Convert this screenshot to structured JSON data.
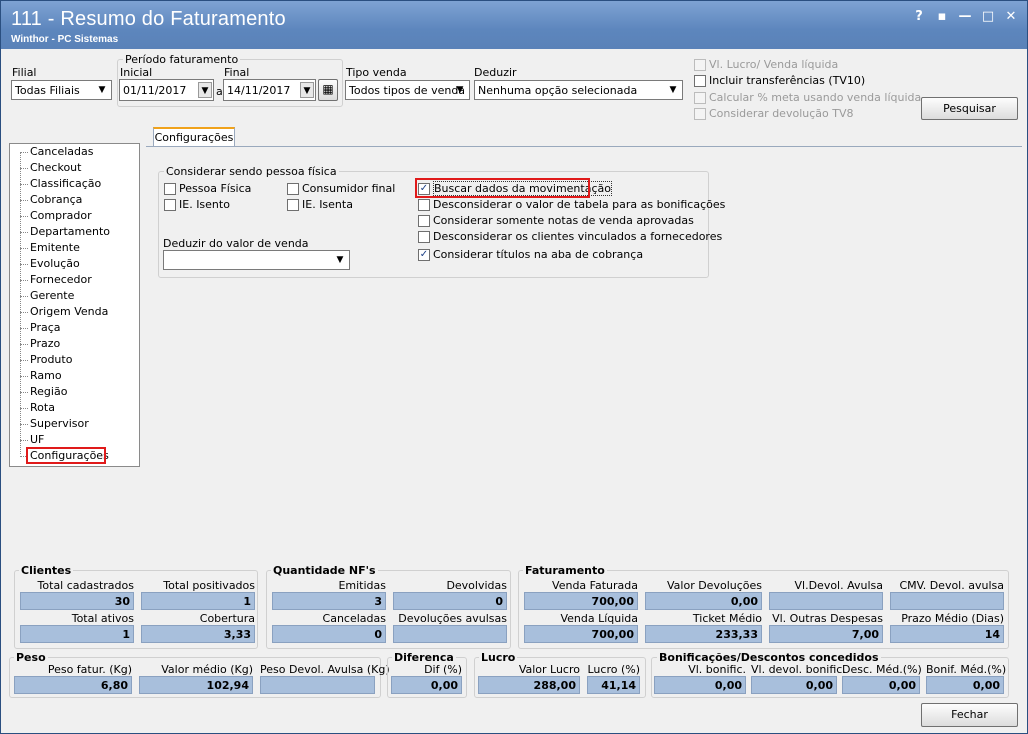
{
  "window": {
    "title": "111 - Resumo do Faturamento",
    "subtitle": "Winthor - PC Sistemas",
    "buttons": [
      "?",
      "▪",
      "—",
      "□",
      "✕"
    ]
  },
  "filters": {
    "filial_label": "Filial",
    "filial_value": "Todas Filiais",
    "periodo_label": "Período faturamento",
    "inicial_label": "Inicial",
    "inicial_value": "01/11/2017",
    "a_label": "a",
    "final_label": "Final",
    "final_value": "14/11/2017",
    "tipo_venda_label": "Tipo venda",
    "tipo_venda_value": "Todos tipos de venda",
    "deduzir_label": "Deduzir",
    "deduzir_value": "Nenhuma opção selecionada"
  },
  "right_options": [
    {
      "label": "Vl. Lucro/ Venda líquida",
      "checked": false,
      "disabled": true
    },
    {
      "label": "Incluir transferências  (TV10)",
      "checked": false,
      "disabled": false
    },
    {
      "label": "Calcular % meta usando venda líquida",
      "checked": false,
      "disabled": true
    },
    {
      "label": "Considerar devolução TV8",
      "checked": false,
      "disabled": true
    }
  ],
  "pesquisar_label": "Pesquisar",
  "tab_label": "Configurações",
  "tree_items": [
    "Canceladas",
    "Checkout",
    "Classificação",
    "Cobrança",
    "Comprador",
    "Departamento",
    "Emitente",
    "Evolução",
    "Fornecedor",
    "Gerente",
    "Origem Venda",
    "Praça",
    "Prazo",
    "Produto",
    "Ramo",
    "Região",
    "Rota",
    "Supervisor",
    "UF",
    "Configurações"
  ],
  "config": {
    "group_title": "Considerar sendo pessoa física",
    "pessoa_fisica": "Pessoa Física",
    "ie_isento": "IE. Isento",
    "consumidor_final": "Consumidor final",
    "ie_isenta": "IE. Isenta",
    "deduzir_valor_label": "Deduzir do valor de venda",
    "deduzir_valor_value": "",
    "options": [
      {
        "label": "Buscar dados da movimentação",
        "checked": true
      },
      {
        "label": "Desconsiderar o valor de tabela para as bonificações",
        "checked": false
      },
      {
        "label": "Considerar somente notas de venda aprovadas",
        "checked": false
      },
      {
        "label": "Desconsiderar os clientes vinculados a fornecedores",
        "checked": false
      },
      {
        "label": "Considerar títulos na aba de cobrança",
        "checked": true
      }
    ]
  },
  "summary": {
    "clientes": {
      "title": "Clientes",
      "total_cadastrados_label": "Total cadastrados",
      "total_cadastrados": "30",
      "total_positivados_label": "Total positivados",
      "total_positivados": "1",
      "total_ativos_label": "Total ativos",
      "total_ativos": "1",
      "cobertura_label": "Cobertura",
      "cobertura": "3,33"
    },
    "nfs": {
      "title": "Quantidade NF's",
      "emitidas_label": "Emitidas",
      "emitidas": "3",
      "devolvidas_label": "Devolvidas",
      "devolvidas": "0",
      "canceladas_label": "Canceladas",
      "canceladas": "0",
      "dev_avulsas_label": "Devoluções avulsas",
      "dev_avulsas": ""
    },
    "faturamento": {
      "title": "Faturamento",
      "venda_faturada_label": "Venda Faturada",
      "venda_faturada": "700,00",
      "valor_devolucoes_label": "Valor Devoluções",
      "valor_devolucoes": "0,00",
      "vl_devol_avulsa_label": "Vl.Devol. Avulsa",
      "vl_devol_avulsa": "",
      "cmv_devol_label": "CMV. Devol. avulsa",
      "cmv_devol": "",
      "venda_liquida_label": "Venda Líquida",
      "venda_liquida": "700,00",
      "ticket_medio_label": "Ticket Médio",
      "ticket_medio": "233,33",
      "outras_despesas_label": "Vl. Outras Despesas",
      "outras_despesas": "7,00",
      "prazo_medio_label": "Prazo Médio (Dias)",
      "prazo_medio": "14"
    },
    "peso": {
      "title": "Peso",
      "peso_fatur_label": "Peso fatur. (Kg)",
      "peso_fatur": "6,80",
      "valor_medio_label": "Valor médio (Kg)",
      "valor_medio": "102,94",
      "peso_devol_label": "Peso Devol. Avulsa (Kg)",
      "peso_devol": ""
    },
    "diferenca": {
      "title": "Diferenca",
      "dif_label": "Dif (%)",
      "dif": "0,00"
    },
    "lucro": {
      "title": "Lucro",
      "valor_lucro_label": "Valor Lucro",
      "valor_lucro": "288,00",
      "lucro_pct_label": "Lucro (%)",
      "lucro_pct": "41,14"
    },
    "bonif": {
      "title": "Bonificações/Descontos concedidos",
      "vl_bonific_label": "Vl. bonific.",
      "vl_bonific": "0,00",
      "vl_devol_bonific_label": "Vl. devol. bonific.",
      "vl_devol_bonific": "0,00",
      "desc_med_label": "Desc. Méd.(%)",
      "desc_med": "0,00",
      "bonif_med_label": "Bonif. Méd.(%)",
      "bonif_med": "0,00"
    }
  },
  "fechar_label": "Fechar"
}
